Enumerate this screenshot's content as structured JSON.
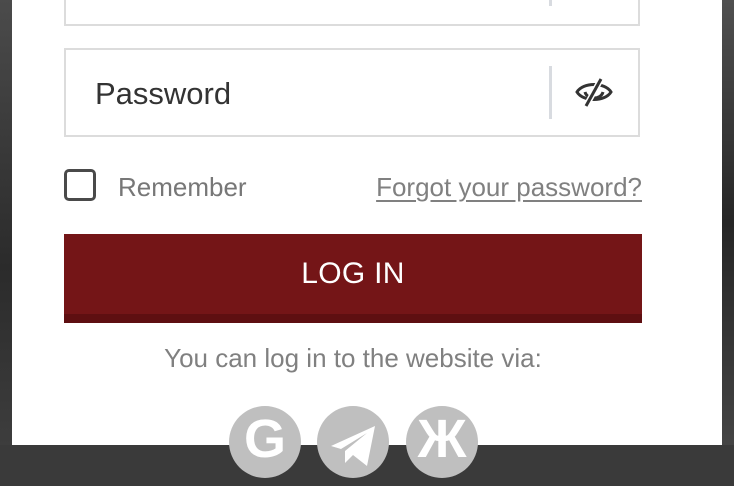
{
  "form": {
    "password_placeholder": "Password",
    "remember_label": "Remember",
    "forgot_link": "Forgot your password?",
    "login_button": "LOG IN",
    "via_text": "You can log in to the website via:"
  },
  "social": [
    {
      "icon": "google-icon",
      "glyph": "G"
    },
    {
      "icon": "telegram-icon"
    },
    {
      "icon": "vk-icon",
      "glyph": "Ж"
    }
  ],
  "colors": {
    "primary_button": "#741517",
    "social_bg": "#bfbfbf",
    "muted_text": "#808080"
  }
}
